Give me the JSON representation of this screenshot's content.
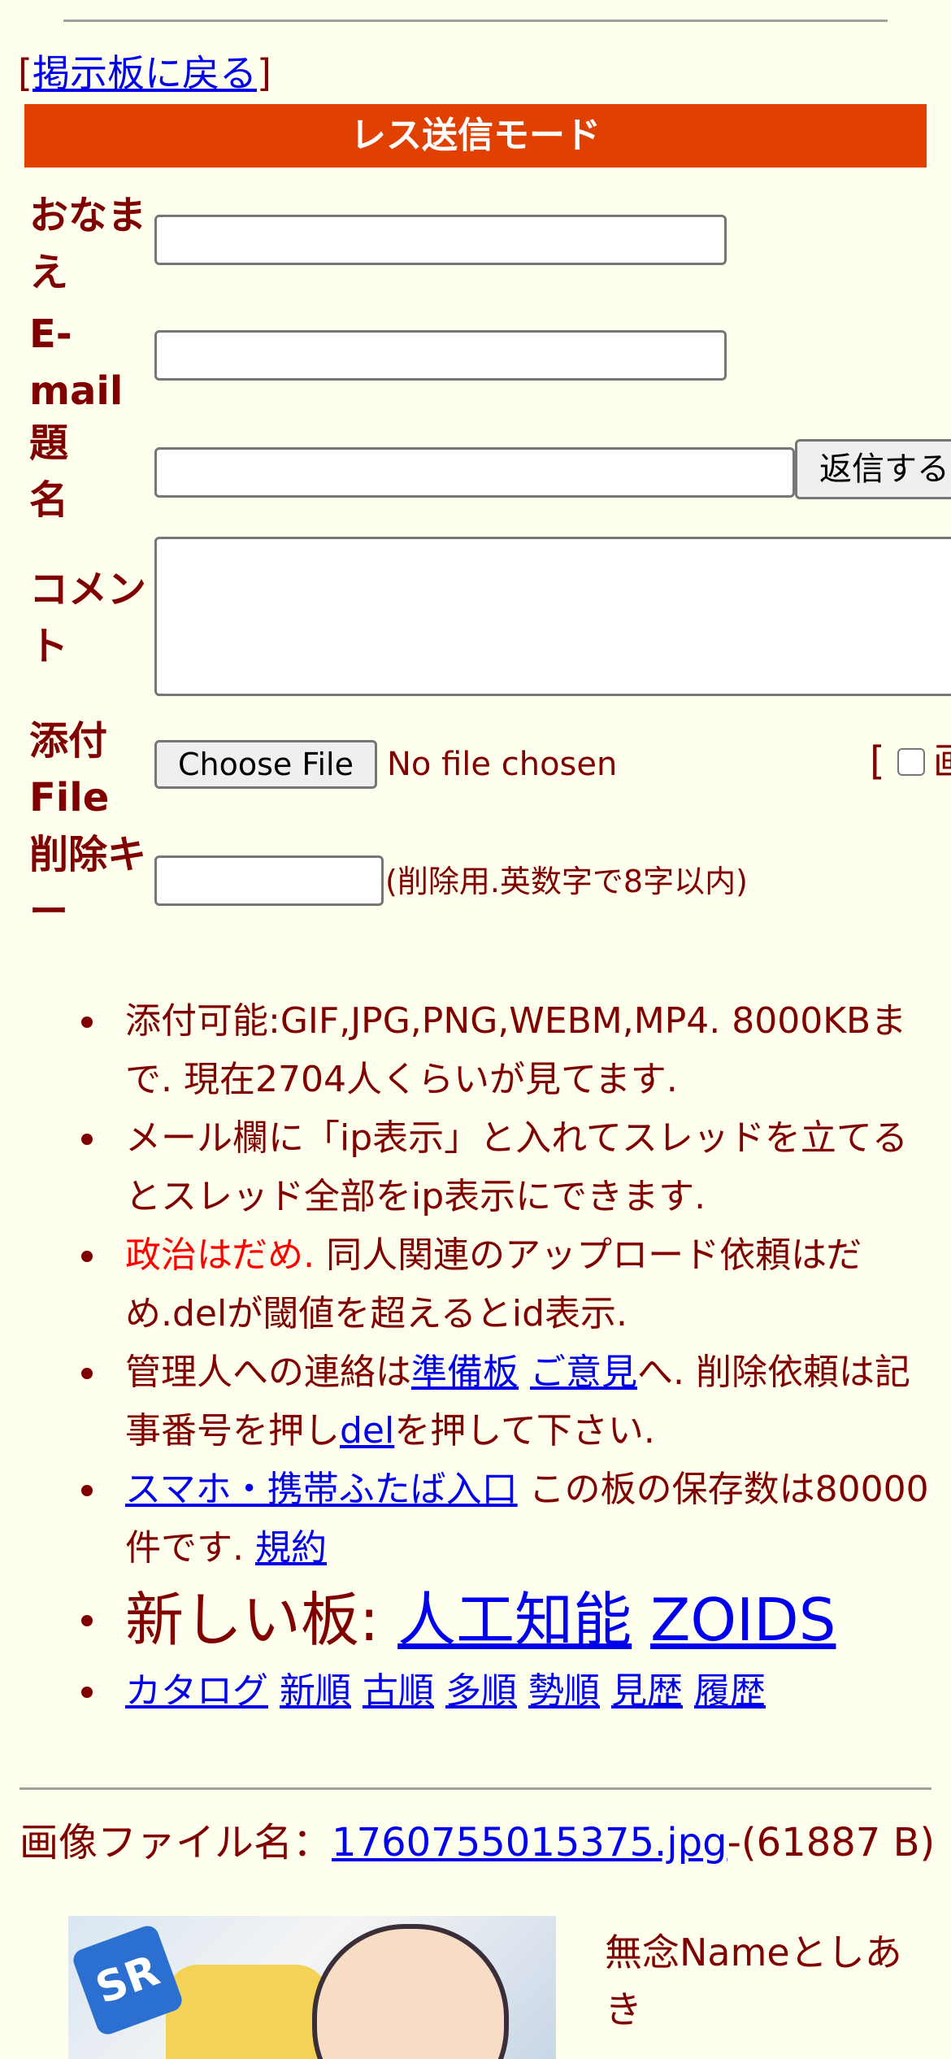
{
  "nav": {
    "back_open": "[",
    "back_link": "掲示板に戻る",
    "back_close": "]"
  },
  "banner": "レス送信モード",
  "form": {
    "name_label": "おなまえ",
    "email_label": "E-mail",
    "subject_label": "題名",
    "submit_label": "返信する",
    "comment_label": "コメント",
    "file_label": "添付File",
    "choose_file_label": "Choose File",
    "no_file_text": "No file chosen",
    "file_extra_bracket": "[",
    "file_extra_text": "画",
    "delkey_label": "削除キー",
    "delkey_note": "(削除用.英数字で8字以内)"
  },
  "rules": {
    "r1": "添付可能:GIF,JPG,PNG,WEBM,MP4. 8000KBまで. 現在2704人くらいが見てます.",
    "r2": "メール欄に「ip表示」と入れてスレッドを立てるとスレッド全部をip表示にできます.",
    "r3_red": "政治はだめ.",
    "r3_rest": " 同人関連のアップロード依頼はだめ.delが閾値を超えるとid表示.",
    "r4_a": "管理人への連絡は",
    "r4_link1": "準備板",
    "r4_link2": "ご意見",
    "r4_b": "へ. 削除依頼は記事番号を押し",
    "r4_link3": "del",
    "r4_c": "を押して下さい.",
    "r5_link": "スマホ・携帯ふたば入口",
    "r5_text": " この板の保存数は80000件です. ",
    "r5_link2": "規約",
    "r6_text": "新しい板: ",
    "r6_link1": "人工知能",
    "r6_link2": "ZOIDS",
    "r7_links": [
      "カタログ",
      "新順",
      "古順",
      "多順",
      "勢順",
      "見歴",
      "履歴"
    ]
  },
  "post": {
    "file_prefix": "画像ファイル名：",
    "file_link": "1760755015375.jpg",
    "file_size": "-(61887 B)",
    "badge": "SR",
    "name": "無念Nameとしあき"
  },
  "colors": {
    "background": "#ffffee",
    "text": "#800000",
    "banner": "#e04000",
    "link": "#0000ee",
    "red": "#ff0000"
  }
}
